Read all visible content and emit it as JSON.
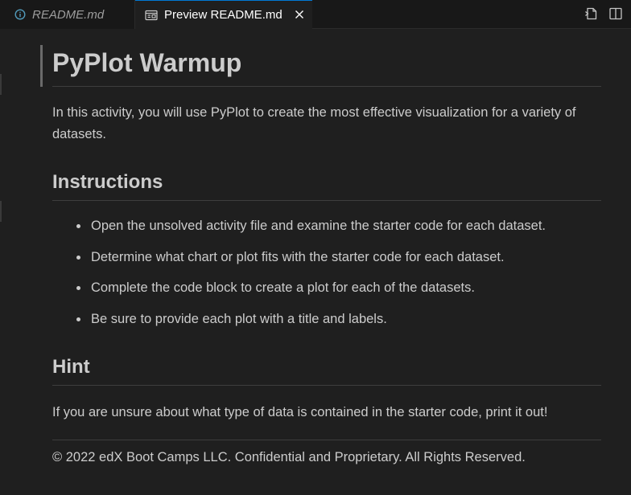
{
  "tabs": [
    {
      "label": "README.md",
      "active": false,
      "icon": "info-icon"
    },
    {
      "label": "Preview README.md",
      "active": true,
      "icon": "preview-icon"
    }
  ],
  "actions": [
    {
      "name": "open-source-icon"
    },
    {
      "name": "split-editor-icon"
    }
  ],
  "doc": {
    "title": "PyPlot Warmup",
    "intro": "In this activity, you will use PyPlot to create the most effective visualization for a variety of datasets.",
    "instructions_heading": "Instructions",
    "instructions": [
      "Open the unsolved activity file and examine the starter code for each dataset.",
      "Determine what chart or plot fits with the starter code for each dataset.",
      "Complete the code block to create a plot for each of the datasets.",
      "Be sure to provide each plot with a title and labels."
    ],
    "hint_heading": "Hint",
    "hint": "If you are unsure about what type of data is contained in the starter code, print it out!",
    "footer": "© 2022 edX Boot Camps LLC. Confidential and Proprietary. All Rights Reserved."
  },
  "colors": {
    "accent": "#0078d4",
    "background": "#1f1f1f",
    "text": "#cccccc"
  }
}
